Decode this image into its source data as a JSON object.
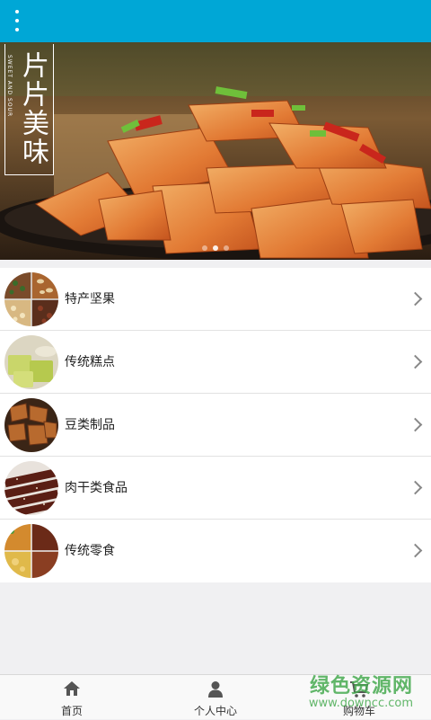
{
  "header": {
    "menu_icon": "more-vertical-icon"
  },
  "banner": {
    "title": "片片美味",
    "subtitle": "SWEET AND SOUR",
    "slides": 3,
    "active_slide": 1
  },
  "categories": [
    {
      "label": "特产坚果",
      "icon": "chevron-right-icon"
    },
    {
      "label": "传统糕点",
      "icon": "chevron-right-icon"
    },
    {
      "label": "豆类制品",
      "icon": "chevron-right-icon"
    },
    {
      "label": "肉干类食品",
      "icon": "chevron-right-icon"
    },
    {
      "label": "传统零食",
      "icon": "chevron-right-icon"
    }
  ],
  "bottom_nav": [
    {
      "label": "首页",
      "icon": "home-icon"
    },
    {
      "label": "个人中心",
      "icon": "user-icon"
    },
    {
      "label": "购物车",
      "icon": "cart-icon"
    }
  ],
  "watermark": {
    "top": "绿色资源网",
    "bottom": "www.downcc.com"
  },
  "colors": {
    "accent": "#00a7d6",
    "background": "#f0f0f2"
  }
}
